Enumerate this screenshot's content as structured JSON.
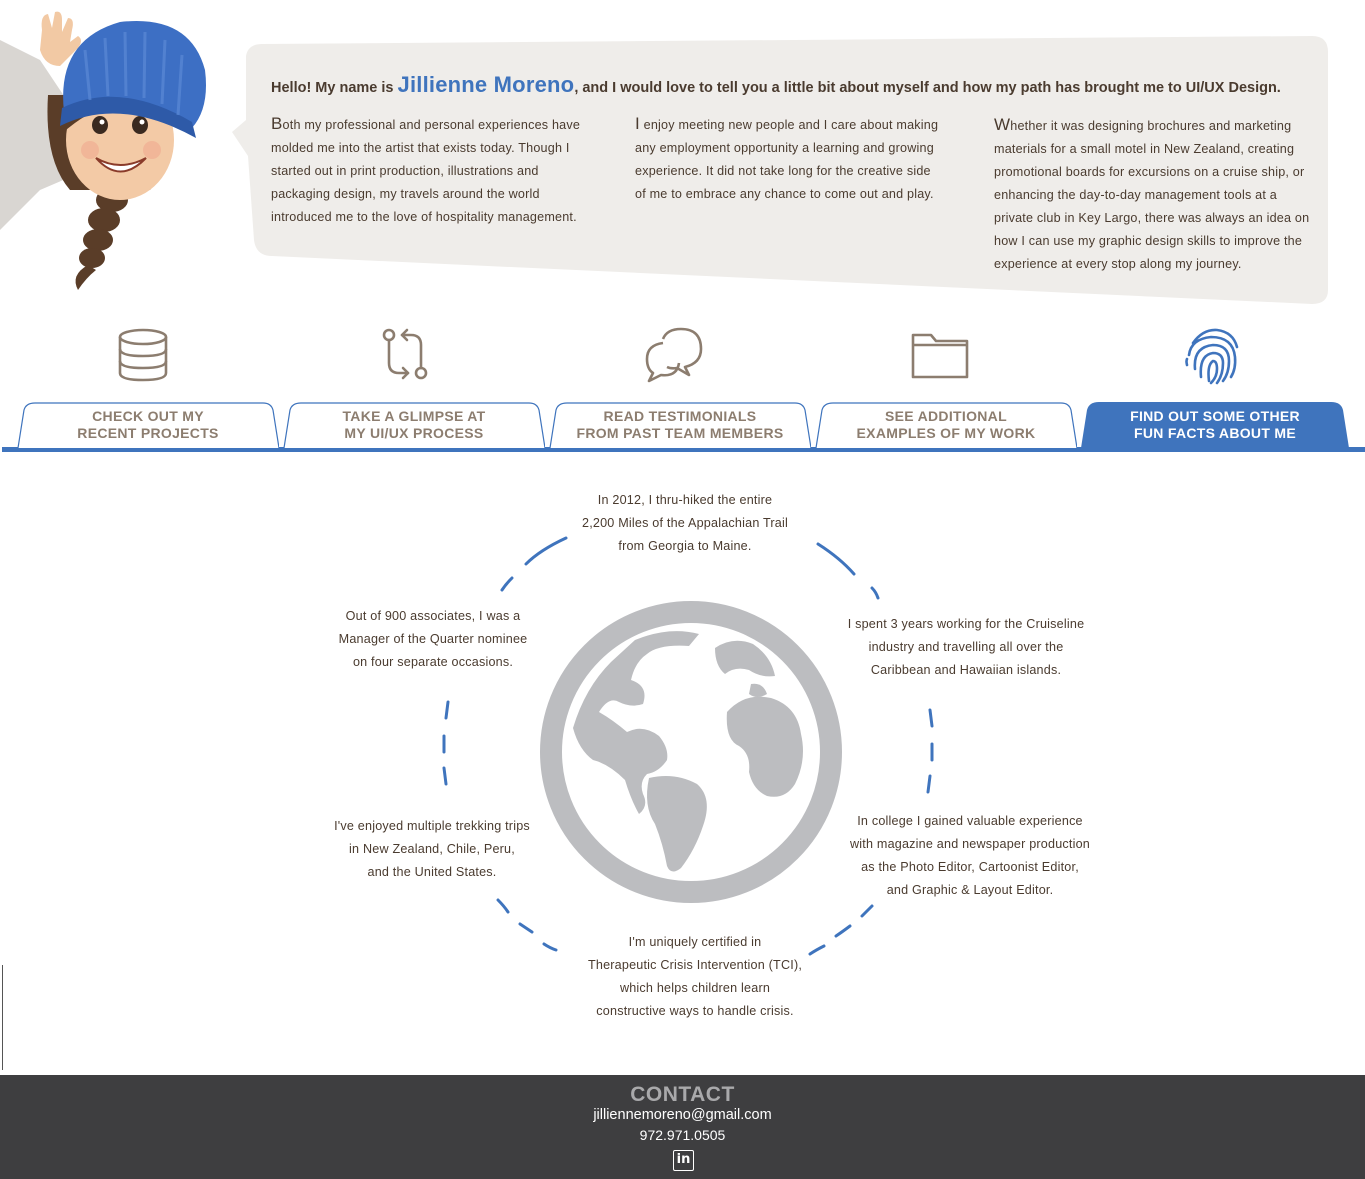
{
  "intro": {
    "heading_before": "Hello! My name is ",
    "name": "Jillienne Moreno",
    "heading_after": ", and I would love to tell you a little bit about myself and how my path has brought me to UI/UX Design.",
    "paragraphs": [
      "Both my professional and personal experiences have molded me into the artist that exists today. Though I started out in print production, illustrations and packaging design, my travels around the world introduced me to the love of hospitality management.",
      "I enjoy meeting new people and I care about making any employment opportunity a learning and growing experience. It did not take long for the creative side of me to embrace any chance to come out and play.",
      "Whether it was designing brochures and marketing materials for a small motel in New Zealand, creating promotional boards for excursions on a cruise ship, or enhancing the day-to-day management tools at a private club in Key Largo, there was always an idea on how I can use my graphic design skills to improve the experience at every stop along my journey."
    ]
  },
  "tabs": [
    {
      "label": "CHECK OUT MY\nRECENT PROJECTS",
      "icon": "database-icon",
      "active": false
    },
    {
      "label": "TAKE A GLIMPSE AT\nMY UI/UX PROCESS",
      "icon": "git-compare-icon",
      "active": false
    },
    {
      "label": "READ TESTIMONIALS\nFROM PAST TEAM MEMBERS",
      "icon": "chat-bubbles-icon",
      "active": false
    },
    {
      "label": "SEE ADDITIONAL\nEXAMPLES OF MY WORK",
      "icon": "folder-icon",
      "active": false
    },
    {
      "label": "FIND OUT SOME OTHER\nFUN FACTS ABOUT ME",
      "icon": "fingerprint-icon",
      "active": true
    }
  ],
  "facts": {
    "top": "In 2012, I thru-hiked the entire\n2,200 Miles of the Appalachian Trail\nfrom Georgia to Maine.",
    "upper_left": "Out of 900 associates, I was a\nManager of the Quarter nominee\non four separate occasions.",
    "upper_right": "I spent 3 years working for the Cruiseline\nindustry and travelling all over the\nCaribbean and Hawaiian islands.",
    "lower_left": "I've enjoyed multiple trekking trips\nin New Zealand, Chile, Peru,\nand the United States.",
    "lower_right": "In college I gained valuable  experience\nwith magazine and newspaper production\nas the Photo Editor, Cartoonist Editor,\nand Graphic & Layout Editor.",
    "bottom": "I'm uniquely certified in\nTherapeutic Crisis Intervention (TCI),\nwhich helps children learn\nconstructive ways to handle crisis."
  },
  "contact": {
    "title": "CONTACT",
    "email": "jilliennemoreno@gmail.com",
    "phone": "972.971.0505",
    "linkedin_label": "in"
  },
  "colors": {
    "accent_blue": "#3f74bd",
    "text_brown": "#4a3b2f",
    "tab_text": "#8c7d6f",
    "bubble_bg": "#efedea",
    "globe_gray": "#bcbdc0",
    "footer_bg": "#3e3e40"
  }
}
